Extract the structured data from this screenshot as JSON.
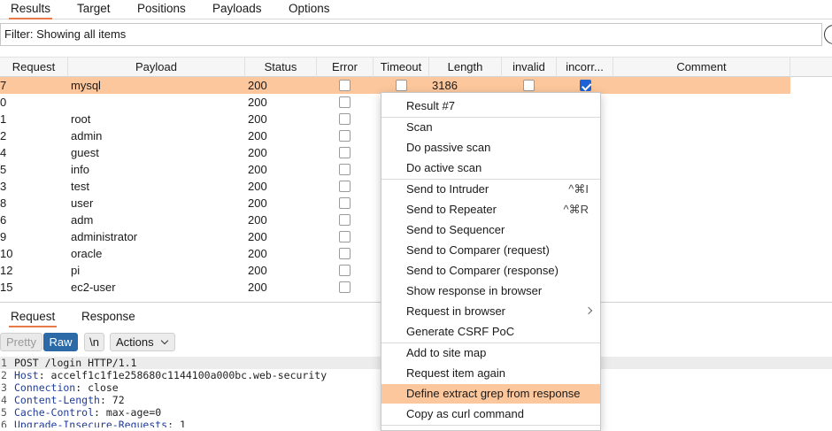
{
  "top_tabs": [
    "Results",
    "Target",
    "Positions",
    "Payloads",
    "Options"
  ],
  "filter": {
    "text": "Filter: Showing all items"
  },
  "table": {
    "columns": [
      "Request",
      "Payload",
      "Status",
      "Error",
      "Timeout",
      "Length",
      "invalid",
      "incorr...",
      "Comment"
    ],
    "rows": [
      {
        "request": "7",
        "payload": "mysql",
        "status": "200",
        "length": "3186",
        "error": false,
        "timeout": false,
        "invalid": false,
        "incorrect": true,
        "selected": true
      },
      {
        "request": "0",
        "payload": "",
        "status": "200",
        "error": false
      },
      {
        "request": "1",
        "payload": "root",
        "status": "200",
        "error": false
      },
      {
        "request": "2",
        "payload": "admin",
        "status": "200",
        "error": false
      },
      {
        "request": "4",
        "payload": "guest",
        "status": "200",
        "error": false
      },
      {
        "request": "5",
        "payload": "info",
        "status": "200",
        "error": false
      },
      {
        "request": "3",
        "payload": "test",
        "status": "200",
        "error": false
      },
      {
        "request": "8",
        "payload": "user",
        "status": "200",
        "error": false
      },
      {
        "request": "6",
        "payload": "adm",
        "status": "200",
        "error": false
      },
      {
        "request": "9",
        "payload": "administrator",
        "status": "200",
        "error": false
      },
      {
        "request": "10",
        "payload": "oracle",
        "status": "200",
        "error": false
      },
      {
        "request": "12",
        "payload": "pi",
        "status": "200",
        "error": false
      },
      {
        "request": "15",
        "payload": "ec2-user",
        "status": "200",
        "error": false
      }
    ]
  },
  "rr_tabs": [
    "Request",
    "Response"
  ],
  "toolbar": {
    "pretty": "Pretty",
    "raw": "Raw",
    "newline": "\\n",
    "actions": "Actions"
  },
  "request_lines": [
    {
      "n": "1",
      "key": "POST /login HTTP/1.1",
      "val": ""
    },
    {
      "n": "2",
      "key": "Host",
      "val": ": accelf1c1f1e258680c1144100a000bc.web-security"
    },
    {
      "n": "3",
      "key": "Connection",
      "val": ": close"
    },
    {
      "n": "4",
      "key": "Content-Length",
      "val": ": 72"
    },
    {
      "n": "5",
      "key": "Cache-Control",
      "val": ": max-age=0"
    },
    {
      "n": "6",
      "key": "Upgrade-Insecure-Requests",
      "val": ": 1"
    }
  ],
  "context_menu": {
    "items": [
      {
        "label": "Result #7"
      },
      {
        "label": "Scan"
      },
      {
        "label": "Do passive scan"
      },
      {
        "label": "Do active scan"
      },
      {
        "label": "Send to Intruder",
        "shortcut": "^⌘I"
      },
      {
        "label": "Send to Repeater",
        "shortcut": "^⌘R"
      },
      {
        "label": "Send to Sequencer"
      },
      {
        "label": "Send to Comparer (request)"
      },
      {
        "label": "Send to Comparer (response)"
      },
      {
        "label": "Show response in browser"
      },
      {
        "label": "Request in browser"
      },
      {
        "label": "Generate CSRF PoC"
      },
      {
        "label": "Add to site map"
      },
      {
        "label": "Request item again"
      },
      {
        "label": "Define extract grep from response"
      },
      {
        "label": "Copy as curl command"
      }
    ]
  },
  "colors": {
    "accent": "#e8794a",
    "selection": "#fcc79c",
    "raw_button": "#2b6aa6",
    "checkbox_checked": "#1d63d6"
  }
}
